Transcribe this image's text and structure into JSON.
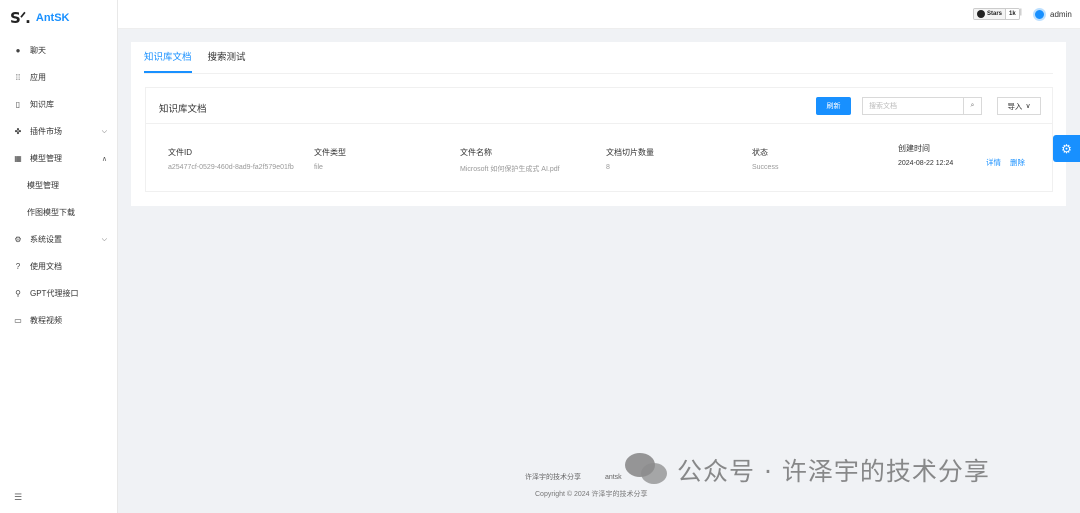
{
  "app": {
    "name": "AntSK",
    "logo_mark": "S",
    "logo_mark_suffix": "ᐟ."
  },
  "sidebar": {
    "items": [
      {
        "label": "聊天",
        "icon": "chat-icon",
        "glyph": "●"
      },
      {
        "label": "应用",
        "icon": "apps-icon",
        "glyph": "⁞⁞"
      },
      {
        "label": "知识库",
        "icon": "book-icon",
        "glyph": "▯"
      },
      {
        "label": "插件市场",
        "icon": "plugin-icon",
        "glyph": "✤",
        "chevron": "down"
      },
      {
        "label": "模型管理",
        "icon": "model-icon",
        "glyph": "▦",
        "chevron": "up",
        "children": [
          {
            "label": "模型管理"
          },
          {
            "label": "作图模型下载"
          }
        ]
      },
      {
        "label": "系统设置",
        "icon": "settings-icon",
        "glyph": "⚙",
        "chevron": "down"
      },
      {
        "label": "使用文档",
        "icon": "help-icon",
        "glyph": "?"
      },
      {
        "label": "GPT代理接口",
        "icon": "location-icon",
        "glyph": "⚲"
      },
      {
        "label": "教程视频",
        "icon": "video-icon",
        "glyph": "▭"
      }
    ],
    "collapse_glyph": "☰"
  },
  "header": {
    "github": {
      "label": "Stars",
      "count": "1k",
      "sep": "|"
    },
    "user": "admin"
  },
  "tabs": [
    {
      "label": "知识库文档",
      "active": true
    },
    {
      "label": "搜索测试",
      "active": false
    }
  ],
  "panel": {
    "title": "知识库文档",
    "refresh_label": "刷新",
    "search_placeholder": "搜索文档",
    "import_label": "导入"
  },
  "table": {
    "columns": [
      "文件ID",
      "文件类型",
      "文件名称",
      "文档切片数量",
      "状态",
      "创建时间"
    ],
    "rows": [
      {
        "id": "a25477cf-0529-460d-8ad9-fa2f579e01fb",
        "type": "file",
        "name": "Microsoft 如何保护生成式 AI.pdf",
        "slices": "8",
        "status": "Success",
        "created": "2024-08-22 12:24",
        "actions": [
          "详情",
          "删除"
        ]
      }
    ]
  },
  "footer": {
    "links": [
      "许泽宇的技术分享",
      "antsk"
    ],
    "copyright": "Copyright © 2024 许泽宇的技术分享"
  },
  "watermark": {
    "text": "公众号 · 许泽宇的技术分享"
  },
  "colors": {
    "accent": "#1890ff",
    "background": "#f0f2f5"
  }
}
